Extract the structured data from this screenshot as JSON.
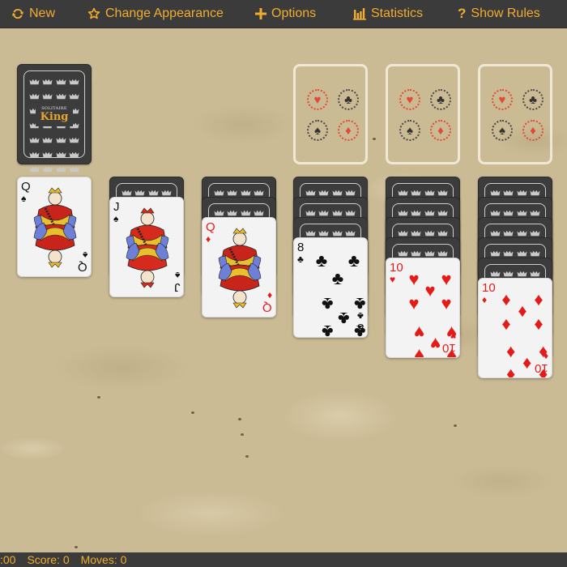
{
  "menu": {
    "new": {
      "label": "New",
      "icon": "refresh-icon"
    },
    "appearance": {
      "label": "Change Appearance",
      "icon": "star-icon"
    },
    "options": {
      "label": "Options",
      "icon": "plus-icon"
    },
    "statistics": {
      "label": "Statistics",
      "icon": "bar-chart-icon"
    },
    "rules": {
      "label": "Show Rules",
      "icon": "question-icon"
    }
  },
  "status": {
    "time": ":00",
    "score": "Score: 0",
    "moves": "Moves: 0"
  },
  "stock": {
    "logo_small": "SOLITAIRE",
    "logo_big": "King"
  },
  "foundations": [
    {
      "suits": [
        "♥",
        "♣",
        "♠",
        "♦"
      ]
    },
    {
      "suits": [
        "♥",
        "♣",
        "♠",
        "♦"
      ]
    },
    {
      "suits": [
        "♥",
        "♣",
        "♠",
        "♦"
      ]
    }
  ],
  "tableau": [
    {
      "face_down": 0,
      "top": {
        "rank": "Q",
        "suit": "♠",
        "color": "black"
      }
    },
    {
      "face_down": 1,
      "top": {
        "rank": "J",
        "suit": "♠",
        "color": "black"
      }
    },
    {
      "face_down": 2,
      "top": {
        "rank": "Q",
        "suit": "♦",
        "color": "red"
      }
    },
    {
      "face_down": 3,
      "top": {
        "rank": "8",
        "suit": "♣",
        "color": "black"
      }
    },
    {
      "face_down": 4,
      "top": {
        "rank": "10",
        "suit": "♥",
        "color": "red"
      }
    },
    {
      "face_down": 5,
      "top": {
        "rank": "10",
        "suit": "♦",
        "color": "red"
      }
    }
  ],
  "colors": {
    "accent": "#f0ad2f",
    "bar_bg": "#3b3b3b",
    "card_back": "#3c3c3c",
    "table": "#cbbb95",
    "red_suit": "#e41b17"
  }
}
